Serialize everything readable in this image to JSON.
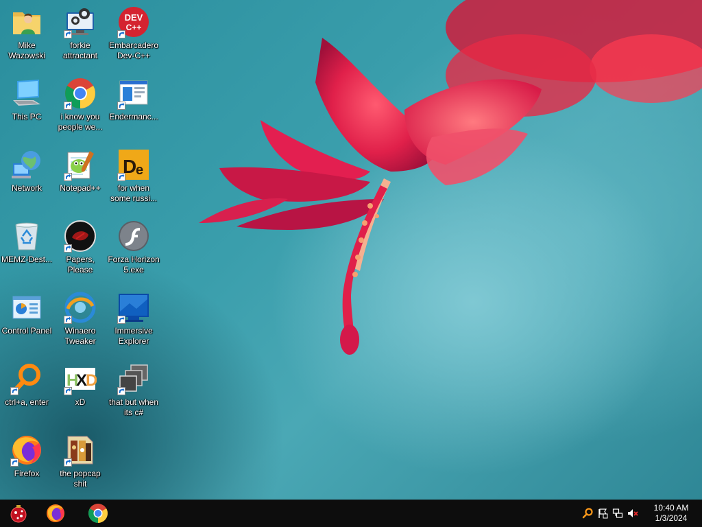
{
  "desktop": {
    "icons": [
      {
        "label": "Mike Wazowski",
        "icon": "folder-user-icon",
        "shortcut": false
      },
      {
        "label": "forkie attractant",
        "icon": "monitor-gears-icon",
        "shortcut": true
      },
      {
        "label": "Embarcadero Dev-C++",
        "icon": "devcpp-icon",
        "shortcut": true
      },
      {
        "label": "This PC",
        "icon": "computer-icon",
        "shortcut": false
      },
      {
        "label": "i know you people we...",
        "icon": "chrome-icon",
        "shortcut": true
      },
      {
        "label": "Endermanc...",
        "icon": "window-app-icon",
        "shortcut": true
      },
      {
        "label": "Network",
        "icon": "network-globe-icon",
        "shortcut": false
      },
      {
        "label": "Notepad++",
        "icon": "notepadpp-icon",
        "shortcut": true
      },
      {
        "label": "for when some russi...",
        "icon": "de-app-icon",
        "shortcut": true
      },
      {
        "label": "MEMZ-Dest...",
        "icon": "recycle-bin-icon",
        "shortcut": false
      },
      {
        "label": "Papers, Please",
        "icon": "papers-please-icon",
        "shortcut": true
      },
      {
        "label": "Forza Horizon 5.exe",
        "icon": "flash-icon",
        "shortcut": false
      },
      {
        "label": "Control Panel",
        "icon": "control-panel-icon",
        "shortcut": false
      },
      {
        "label": "Winaero Tweaker",
        "icon": "winaero-icon",
        "shortcut": true
      },
      {
        "label": "Immersive Explorer",
        "icon": "immersive-explorer-icon",
        "shortcut": true
      },
      {
        "label": "ctrl+a, enter",
        "icon": "magnifier-icon",
        "shortcut": true
      },
      {
        "label": "xD",
        "icon": "hxd-icon",
        "shortcut": true
      },
      {
        "label": "that but when its c#",
        "icon": "stacked-windows-icon",
        "shortcut": true
      },
      {
        "label": "Firefox",
        "icon": "firefox-icon",
        "shortcut": true
      },
      {
        "label": "the popcap shit",
        "icon": "popcap-folder-icon",
        "shortcut": true
      }
    ]
  },
  "taskbar": {
    "pinned": [
      {
        "name": "start-ornament-icon"
      },
      {
        "name": "firefox-icon"
      },
      {
        "name": "chrome-icon"
      }
    ],
    "tray": [
      {
        "name": "search-magnifier-icon"
      },
      {
        "name": "action-center-flag-icon"
      },
      {
        "name": "network-icon"
      },
      {
        "name": "volume-muted-icon"
      }
    ],
    "clock": {
      "time": "10:40 AM",
      "date": "1/3/2024"
    }
  },
  "colors": {
    "taskbar": "#0d0d0d",
    "wallpaper": "#3a9eac",
    "flower": "#e0204a"
  }
}
